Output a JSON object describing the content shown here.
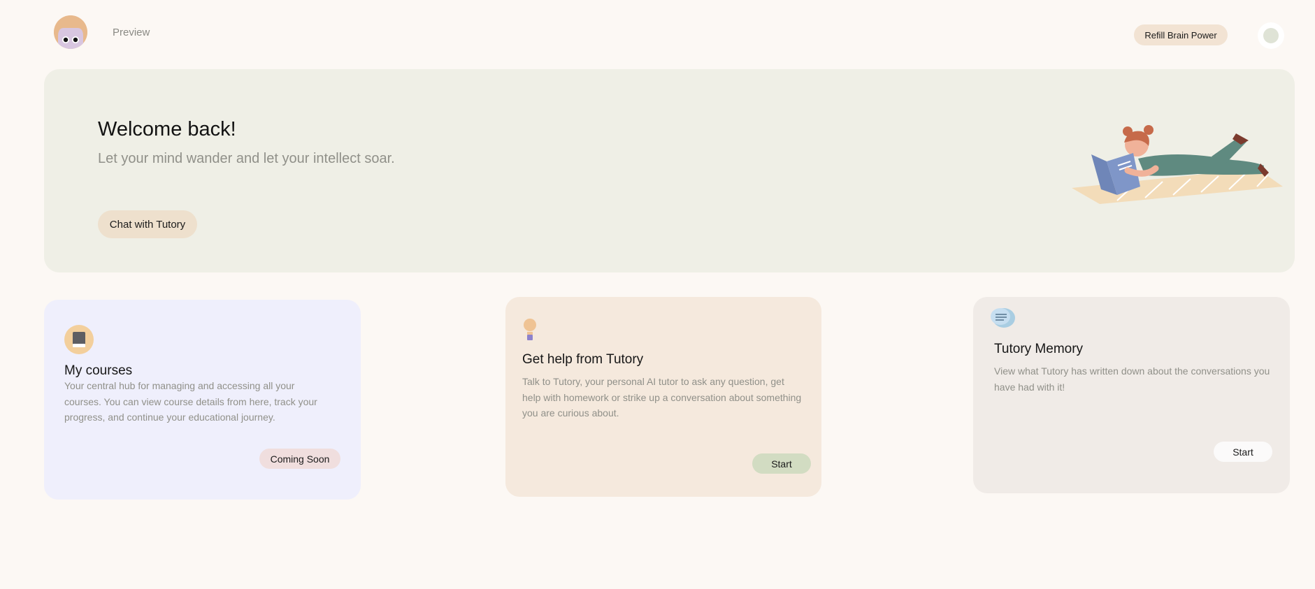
{
  "header": {
    "preview_label": "Preview",
    "refill_label": "Refill Brain Power"
  },
  "hero": {
    "title": "Welcome back!",
    "subtitle": "Let your mind wander and let your intellect soar.",
    "cta_label": "Chat with Tutory",
    "illustration": "girl-reading-on-blanket"
  },
  "cards": [
    {
      "icon": "book-icon",
      "title": "My courses",
      "description": "Your central hub for managing and accessing all your courses. You can view course details from here, track your progress, and continue your educational journey.",
      "button_label": "Coming Soon"
    },
    {
      "icon": "lightbulb-icon",
      "title": "Get help from Tutory",
      "description": "Talk to Tutory, your personal AI tutor to ask any question, get help with homework or strike up a conversation about something you are curious about.",
      "button_label": "Start"
    },
    {
      "icon": "chat-bubble-icon",
      "title": "Tutory Memory",
      "description": "View what Tutory has written down about the conversations you have had with it!",
      "button_label": "Start"
    }
  ],
  "colors": {
    "page_bg": "#fcf8f4",
    "hero_bg": "#efefe6",
    "courses_card_bg": "#efeffc",
    "help_card_bg": "#f5e9dd",
    "memory_card_bg": "#f0ebe7",
    "refill_button_bg": "#f2e3d3",
    "start_green": "#d2dcc2"
  }
}
